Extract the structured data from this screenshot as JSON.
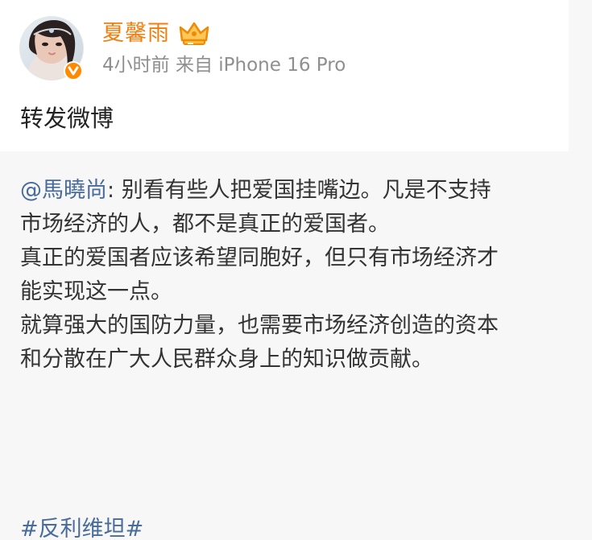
{
  "author": {
    "name": "夏馨雨",
    "avatar_icon": "avatar-photo",
    "badge_icon": "verified-orange-badge",
    "member_icon": "crown-icon",
    "time": "4小时前",
    "source": "来自 iPhone 16 Pro"
  },
  "post": {
    "text": "转发微博"
  },
  "repost": {
    "mention": "@馬曉尚",
    "separator": ": ",
    "paragraph1_line1": "别看有些人把爱国挂嘴边。凡是不支持",
    "paragraph1_line2": "市场经济的人，都不是真正的爱国者。",
    "paragraph2_line1": "真正的爱国者应该希望同胞好，但只有市场经济才",
    "paragraph2_line2": "能实现这一点。",
    "paragraph3_line1": "就算强大的国防力量，也需要市场经济创造的资本",
    "paragraph3_line2": "和分散在广大人民群众身上的知识做贡献。",
    "hashtag": "#反利维坦#"
  },
  "colors": {
    "username": "#f27d0c",
    "link": "#476b9a",
    "meta": "#8f8f8f",
    "body": "#333333",
    "background": "#f7f7f7",
    "card": "#ffffff"
  }
}
